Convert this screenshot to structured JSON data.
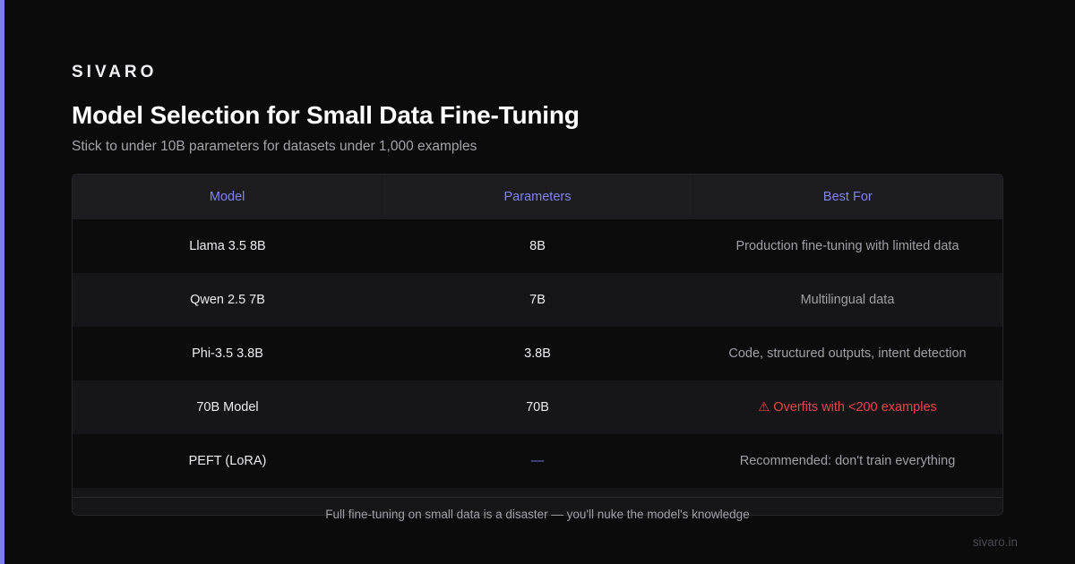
{
  "brand": "SIVARO",
  "title": "Model Selection for Small Data Fine-Tuning",
  "subtitle": "Stick to under 10B parameters for datasets under 1,000 examples",
  "table": {
    "headers": [
      "Model",
      "Parameters",
      "Best For"
    ],
    "rows": [
      {
        "model": "Llama 3.5 8B",
        "params": "8B",
        "best": "Production fine-tuning with limited data"
      },
      {
        "model": "Qwen 2.5 7B",
        "params": "7B",
        "best": "Multilingual data"
      },
      {
        "model": "Phi-3.5 3.8B",
        "params": "3.8B",
        "best": "Code, structured outputs, intent detection"
      },
      {
        "model": "70B Model",
        "params": "70B",
        "best": "⚠ Overfits with <200 examples"
      },
      {
        "model": "PEFT (LoRA)",
        "params": "—",
        "best": "Recommended: don't train everything"
      }
    ]
  },
  "footnote": "Full fine-tuning on small data is a disaster — you'll nuke the model's knowledge",
  "url": "sivaro.in",
  "colors": {
    "accent": "#7b7ff0",
    "header_text": "#8085ef",
    "warning": "#e5484d",
    "background": "#0b0b0c"
  }
}
